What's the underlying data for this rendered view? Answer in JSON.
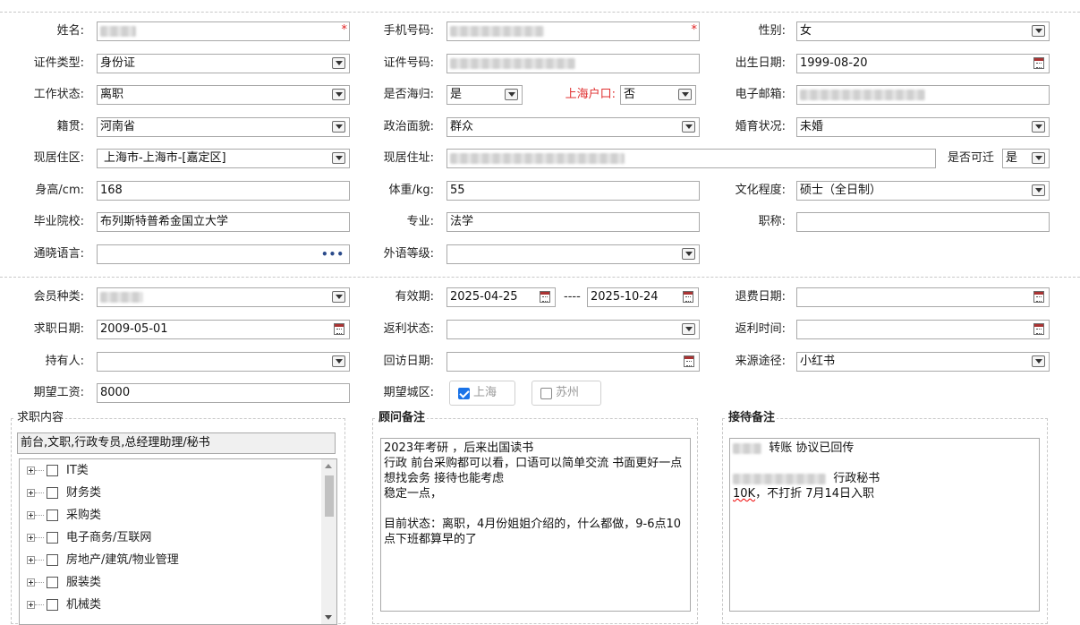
{
  "labels": {
    "name": "姓名:",
    "phone": "手机号码:",
    "gender": "性别:",
    "id_type": "证件类型:",
    "id_no": "证件号码:",
    "birth": "出生日期:",
    "work_status": "工作状态:",
    "returnee": "是否海归:",
    "sh_hukou": "上海户口:",
    "email": "电子邮箱:",
    "native": "籍贯:",
    "political": "政治面貌:",
    "marital": "婚育状况:",
    "cur_district": "现居住区:",
    "cur_address": "现居住址:",
    "relocate": "是否可迁",
    "height": "身高/cm:",
    "weight": "体重/kg:",
    "education": "文化程度:",
    "school": "毕业院校:",
    "major": "专业:",
    "title": "职称:",
    "language": "通晓语言:",
    "foreign_level": "外语等级:",
    "member_type": "会员种类:",
    "valid_period": "有效期:",
    "refund_date": "退费日期:",
    "job_date": "求职日期:",
    "rebate_status": "返利状态:",
    "rebate_time": "返利时间:",
    "holder": "持有人:",
    "visit_date": "回访日期:",
    "source": "来源途径:",
    "salary": "期望工资:",
    "city": "期望城区:"
  },
  "values": {
    "gender": "女",
    "id_type": "身份证",
    "birth": "1999-08-20",
    "work_status": "离职",
    "returnee": "是",
    "sh_hukou": "否",
    "native": "河南省",
    "political": "群众",
    "marital": "未婚",
    "cur_district": "上海市-上海市-[嘉定区]",
    "relocate": "是",
    "height": "168",
    "weight": "55",
    "education": "硕士（全日制）",
    "school": "布列斯特普希金国立大学",
    "major": "法学",
    "title": "",
    "language": "",
    "foreign_level": "",
    "valid_from": "2025-04-25",
    "valid_sep": "----",
    "valid_to": "2025-10-24",
    "refund_date": "",
    "job_date": "2009-05-01",
    "rebate_status": "",
    "rebate_time": "",
    "holder": "",
    "visit_date": "",
    "source": "小红书",
    "salary": "8000"
  },
  "cities": [
    {
      "label": "上海",
      "checked": true
    },
    {
      "label": "苏州",
      "checked": false
    }
  ],
  "job": {
    "legend": "求职内容",
    "summary": "前台,文职,行政专员,总经理助理/秘书",
    "tree": [
      "IT类",
      "财务类",
      "采购类",
      "电子商务/互联网",
      "房地产/建筑/物业管理",
      "服装类",
      "机械类"
    ]
  },
  "advisor": {
    "legend": "顾问备注",
    "text": "2023年考研 ，后来出国读书\n行政 前台采购都可以看，口语可以简单交流 书面更好一点\n想找会务 接待也能考虑\n稳定一点，\n\n目前状态：离职，4月份姐姐介绍的，什么都做，9-6点10点下班都算早的了"
  },
  "reception": {
    "legend": "接待备注",
    "line1": "转账 协议已回传",
    "line2": "行政秘书",
    "line3a": "10K",
    "line3b": "，不打折 7月14日入职"
  }
}
